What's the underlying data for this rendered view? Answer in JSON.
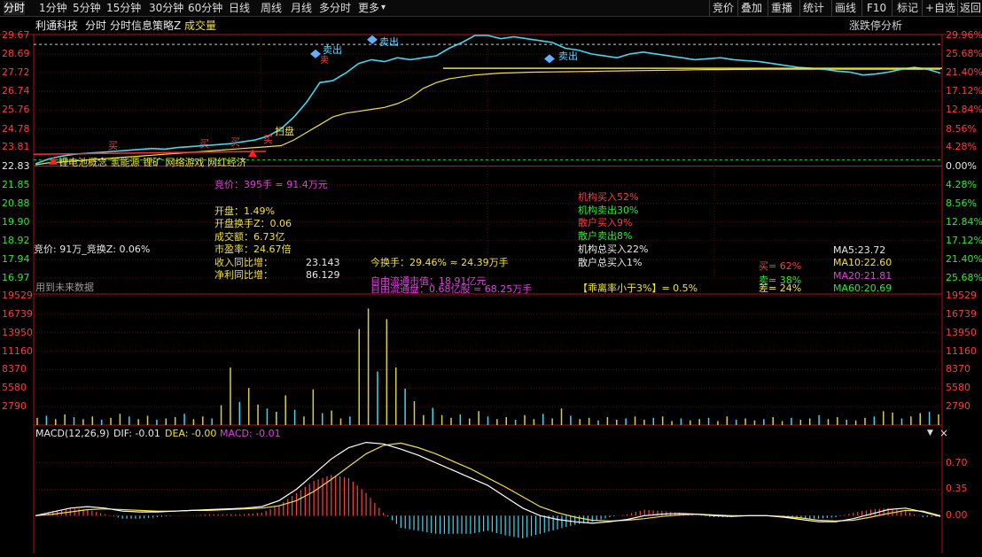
{
  "toolbar": {
    "tabs": [
      "分时",
      "1分钟",
      "5分钟",
      "15分钟",
      "30分钟",
      "60分钟",
      "日线",
      "周线",
      "月线",
      "多分时",
      "更多"
    ],
    "more_arrow": "▾",
    "right_buttons": [
      "竞价",
      "叠加",
      "重播",
      "统计",
      "画线",
      "F10",
      "标记",
      "+自选",
      "返回"
    ]
  },
  "header": {
    "stock_name": "利通科技",
    "chart_title": "分时",
    "indicator_name": "分时信息策略Z",
    "volume_label": "成交量",
    "right_link": "涨跌停分析"
  },
  "price_axis": {
    "left": [
      "29.67",
      "28.69",
      "27.72",
      "26.74",
      "25.76",
      "24.78",
      "23.81",
      "22.83",
      "21.85",
      "20.88",
      "19.90",
      "18.92",
      "17.94",
      "16.97"
    ],
    "right": [
      "29.96%",
      "25.68%",
      "21.40%",
      "17.12%",
      "12.84%",
      "8.56%",
      "4.28%",
      "0.00%",
      "4.28%",
      "8.56%",
      "12.84%",
      "17.12%",
      "21.40%",
      "25.68%"
    ]
  },
  "volume_axis": {
    "left": [
      "19529",
      "16739",
      "13950",
      "11160",
      "8370",
      "5580",
      "2790"
    ],
    "right": [
      "19529",
      "16739",
      "13950",
      "11160",
      "8370",
      "5580",
      "2790"
    ]
  },
  "macd_axis": [
    "0.70",
    "0.35",
    "0.00"
  ],
  "concept_tags": "锂电池概念 氢能源 锂矿 网络游戏 网红经济",
  "markers": {
    "sell1": "卖出",
    "sell2": "卖出",
    "sell3": "卖出",
    "buy1": "买",
    "buy2": "买",
    "buy3": "买",
    "buy4": "买",
    "sweep": "扫盘",
    "small_char": "卖"
  },
  "info": {
    "auction": "竞价：395手 = 91.4万元",
    "open_pct": "开盘：1.49%",
    "open_turnover": "开盘换手Z：0.06",
    "amount": "成交额：6.73亿",
    "pe": "市盈率：24.67倍",
    "revenue_label": "收入同比增：",
    "revenue_value": "23.143",
    "profit_label": "净利同比增：",
    "profit_value": "86.129",
    "turnover_today": "今换手：29.46% ≈ 24.39万手",
    "float_mktcap": "自由流通市值：18.91亿元",
    "float_shares": "自由流通盘：0.68亿股 ≈ 68.25万手",
    "deviation": "【乖离率小于3%】= 0.5%",
    "inst_buy": "机构买入52%",
    "inst_sell": "机构卖出30%",
    "retail_buy": "散户买入9%",
    "retail_sell": "散户卖出8%",
    "inst_total": "机构总买入22%",
    "retail_total": "散户总买入1%",
    "auction_turnover": "竞价: 91万_竞换Z: 0.06%",
    "future_data": "用到未来数据",
    "buy_ratio": "买= 62%",
    "sell_ratio": "卖= 38%",
    "diff_ratio": "差= 24%",
    "ma5": "MA5:23.72",
    "ma10": "MA10:22.60",
    "ma20": "MA20:21.81",
    "ma60": "MA60:20.69"
  },
  "macd": {
    "label": "MACD(12,26,9)",
    "dif": "DIF: -0.01",
    "dea": "DEA: -0.00",
    "macd": "MACD: -0.01"
  },
  "chart_data": {
    "type": "line",
    "title": "分时",
    "prev_close": 22.83,
    "ylim": [
      16.97,
      29.67
    ],
    "price_series_name": "分时",
    "price": [
      22.95,
      23.2,
      23.35,
      23.45,
      23.5,
      23.55,
      23.6,
      23.65,
      23.7,
      23.75,
      23.72,
      23.8,
      23.85,
      23.9,
      23.95,
      24.0,
      24.1,
      24.2,
      24.4,
      24.78,
      25.4,
      26.2,
      27.2,
      27.3,
      27.7,
      28.2,
      28.4,
      28.3,
      28.5,
      28.4,
      28.5,
      28.6,
      29.0,
      29.3,
      29.67,
      29.67,
      29.5,
      29.6,
      29.5,
      29.4,
      29.3,
      29.0,
      28.9,
      28.7,
      28.6,
      28.5,
      28.7,
      28.8,
      28.7,
      28.6,
      28.5,
      28.4,
      28.45,
      28.5,
      28.4,
      28.35,
      28.3,
      28.2,
      28.1,
      28.0,
      27.95,
      27.9,
      27.8,
      27.75,
      27.6,
      27.65,
      27.75,
      27.9,
      28.0,
      27.9,
      27.7
    ],
    "avg": [
      22.9,
      23.0,
      23.05,
      23.1,
      23.15,
      23.2,
      23.25,
      23.3,
      23.35,
      23.4,
      23.45,
      23.5,
      23.55,
      23.6,
      23.65,
      23.7,
      23.75,
      23.8,
      23.85,
      23.9,
      24.2,
      24.6,
      25.0,
      25.4,
      25.6,
      25.7,
      25.8,
      25.9,
      26.1,
      26.4,
      26.9,
      27.2,
      27.4,
      27.5,
      27.6,
      27.65,
      27.7,
      27.72,
      27.74,
      27.75,
      27.76,
      27.77,
      27.78,
      27.79,
      27.8,
      27.81,
      27.82,
      27.83,
      27.84,
      27.85,
      27.86,
      27.87,
      27.88,
      27.88,
      27.89,
      27.89,
      27.9,
      27.9,
      27.9,
      27.9,
      27.9,
      27.9,
      27.9,
      27.9,
      27.9,
      27.9,
      27.9,
      27.9,
      27.9,
      27.9,
      27.9
    ],
    "volume_ylim": [
      0,
      19529
    ],
    "volume": [
      1100,
      1400,
      900,
      1600,
      1200,
      900,
      1300,
      800,
      1100,
      1700,
      1300,
      900,
      1400,
      800,
      1000,
      1200,
      1700,
      900,
      1300,
      1000,
      3000,
      8700,
      3500,
      5600,
      3100,
      2500,
      2000,
      4500,
      2300,
      1300,
      5400,
      1800,
      2200,
      1000,
      1300,
      14500,
      17600,
      8100,
      16000,
      8700,
      5500,
      3600,
      1500,
      2600,
      1500,
      1100,
      1600,
      1000,
      2100,
      1300,
      900,
      1200,
      800,
      1500,
      900,
      1700,
      1000,
      2500,
      1400,
      900,
      1100,
      700,
      1200,
      800,
      1000,
      1300,
      800,
      1100,
      1300,
      600,
      1000,
      700,
      900,
      1100,
      600,
      1300,
      800,
      1000,
      700,
      900,
      1200,
      600,
      1100,
      800,
      1000,
      1500,
      900,
      1200,
      800,
      700,
      1100,
      1300,
      2100,
      1900,
      1000,
      1300,
      1800,
      2000,
      1600
    ],
    "macd_ylim": [
      -0.5,
      1.0
    ],
    "dif": [
      0.0,
      0.05,
      0.1,
      0.12,
      0.1,
      0.06,
      0.05,
      0.05,
      0.06,
      0.07,
      0.08,
      0.09,
      0.1,
      0.12,
      0.2,
      0.35,
      0.55,
      0.75,
      0.9,
      0.97,
      0.95,
      0.88,
      0.8,
      0.7,
      0.6,
      0.5,
      0.4,
      0.25,
      0.1,
      0.0,
      -0.05,
      -0.08,
      -0.1,
      -0.08,
      -0.05,
      0.0,
      0.02,
      0.03,
      0.02,
      0.0,
      -0.01,
      0.0,
      0.0,
      -0.02,
      -0.05,
      -0.08,
      -0.08,
      -0.04,
      0.02,
      0.08,
      0.1,
      0.05,
      -0.01
    ],
    "dea": [
      0.0,
      0.02,
      0.05,
      0.08,
      0.09,
      0.08,
      0.07,
      0.06,
      0.06,
      0.07,
      0.07,
      0.08,
      0.09,
      0.1,
      0.13,
      0.2,
      0.32,
      0.48,
      0.65,
      0.82,
      0.93,
      0.96,
      0.9,
      0.82,
      0.72,
      0.62,
      0.5,
      0.38,
      0.25,
      0.12,
      0.04,
      -0.02,
      -0.06,
      -0.07,
      -0.06,
      -0.04,
      -0.01,
      0.01,
      0.02,
      0.01,
      0.0,
      0.0,
      0.0,
      -0.01,
      -0.03,
      -0.06,
      -0.07,
      -0.06,
      -0.02,
      0.03,
      0.07,
      0.06,
      -0.0
    ],
    "macd_bars": [
      0.0,
      0.06,
      0.1,
      0.08,
      0.02,
      -0.04,
      -0.04,
      -0.02,
      0.0,
      0.0,
      0.02,
      0.02,
      0.02,
      0.04,
      0.14,
      0.3,
      0.46,
      0.54,
      0.5,
      0.3,
      0.04,
      -0.16,
      -0.2,
      -0.24,
      -0.24,
      -0.24,
      -0.2,
      -0.26,
      -0.3,
      -0.24,
      -0.18,
      -0.12,
      -0.08,
      -0.02,
      0.02,
      0.08,
      0.06,
      0.04,
      0.0,
      -0.02,
      -0.02,
      0.0,
      0.0,
      -0.02,
      -0.04,
      -0.04,
      -0.02,
      0.04,
      0.08,
      0.1,
      0.06,
      -0.02,
      -0.01
    ]
  }
}
